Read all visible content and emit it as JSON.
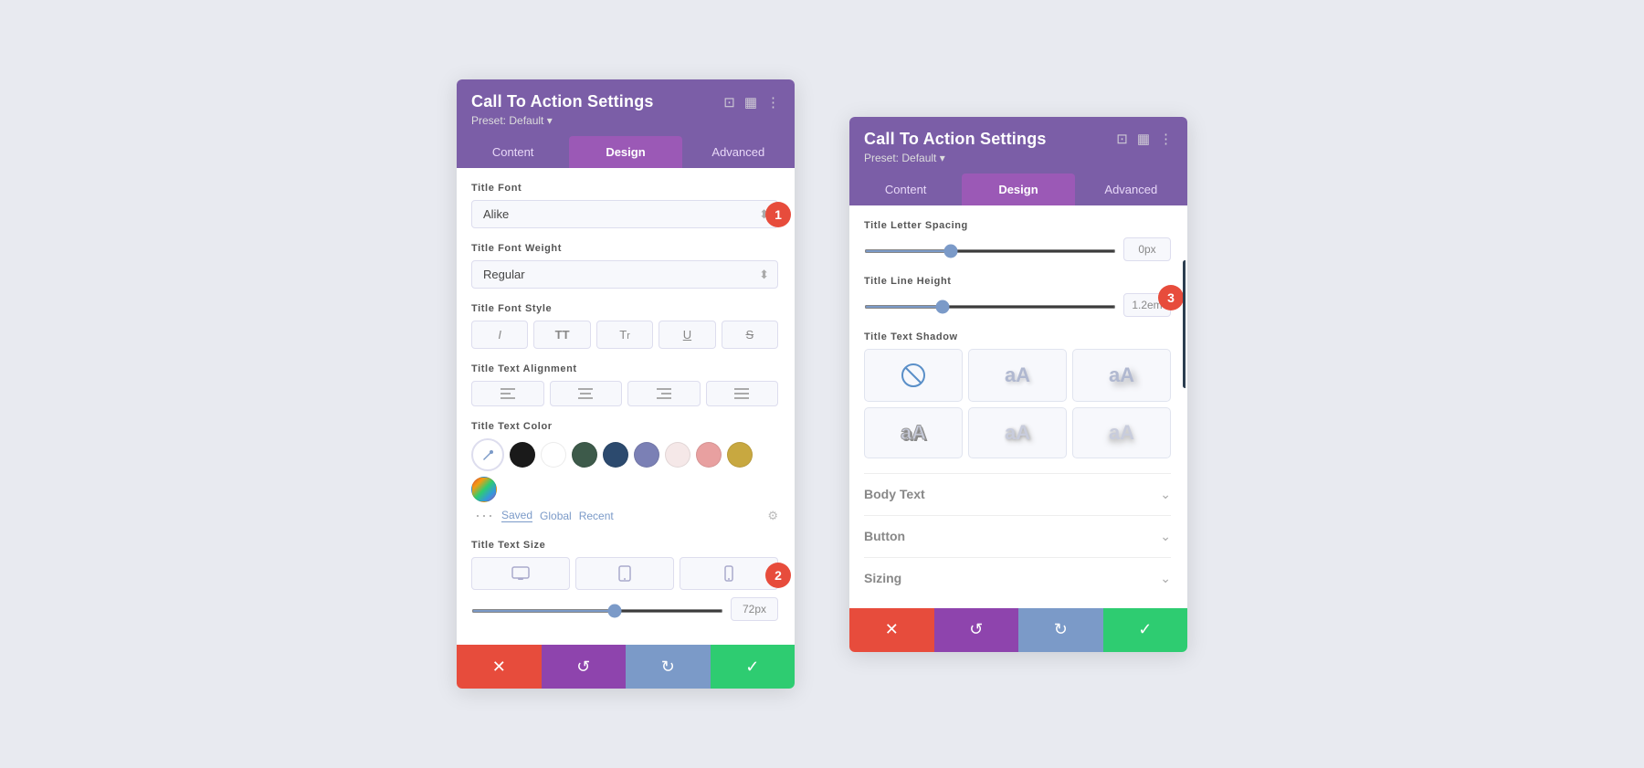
{
  "panel1": {
    "title": "Call To Action Settings",
    "preset": "Preset: Default ▾",
    "tabs": [
      {
        "label": "Content",
        "active": false
      },
      {
        "label": "Design",
        "active": true
      },
      {
        "label": "Advanced",
        "active": false
      }
    ],
    "sections": {
      "titleFont": {
        "label": "Title Font",
        "value": "Alike"
      },
      "titleFontWeight": {
        "label": "Title Font Weight",
        "value": "Regular"
      },
      "titleFontStyle": {
        "label": "Title Font Style",
        "buttons": [
          "I",
          "TT",
          "Tr",
          "U",
          "S"
        ]
      },
      "titleTextAlignment": {
        "label": "Title Text Alignment",
        "buttons": [
          "≡",
          "≡",
          "≡",
          "≡"
        ]
      },
      "titleTextColor": {
        "label": "Title Text Color",
        "colors": [
          "#1a1a1a",
          "#ffffff",
          "#3d5a4a",
          "#2c4a6e",
          "#7b80b5",
          "#f5e8e8",
          "#e8a0a0",
          "#c8a840",
          "gradient"
        ],
        "meta": [
          "Saved",
          "Global",
          "Recent"
        ]
      },
      "titleTextSize": {
        "label": "Title Text Size",
        "value": "72px",
        "sliderValue": 72
      }
    },
    "footer": {
      "cancel": "✕",
      "undo": "↺",
      "redo": "↻",
      "save": "✓"
    },
    "badge1": "1",
    "badge2": "2"
  },
  "panel2": {
    "title": "Call To Action Settings",
    "preset": "Preset: Default ▾",
    "tabs": [
      {
        "label": "Content",
        "active": false
      },
      {
        "label": "Design",
        "active": true
      },
      {
        "label": "Advanced",
        "active": false
      }
    ],
    "sections": {
      "titleLetterSpacing": {
        "label": "Title Letter Spacing",
        "value": "0px",
        "sliderValue": 0
      },
      "titleLineHeight": {
        "label": "Title Line Height",
        "value": "1.2em",
        "sliderValue": 30
      },
      "titleTextShadow": {
        "label": "Title Text Shadow"
      },
      "bodyText": {
        "label": "Body Text"
      },
      "button": {
        "label": "Button"
      },
      "sizing": {
        "label": "Sizing"
      }
    },
    "footer": {
      "cancel": "✕",
      "undo": "↺",
      "redo": "↻",
      "save": "✓"
    },
    "badge3": "3"
  }
}
